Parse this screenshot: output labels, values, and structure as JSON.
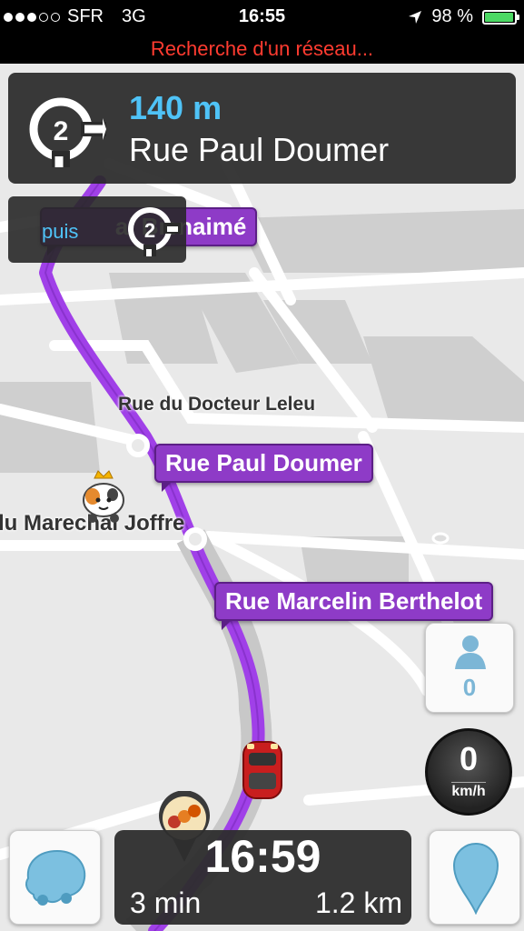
{
  "status_bar": {
    "carrier": "SFR",
    "network": "3G",
    "time": "16:55",
    "battery": "98 %",
    "battery_level": 0.98,
    "signal_bars_filled": 3,
    "signal_bars_total": 5
  },
  "network_banner": "Recherche d'un réseau...",
  "next_turn": {
    "distance": "140 m",
    "street": "Rue Paul Doumer",
    "exit_number": "2",
    "icon": "roundabout-icon"
  },
  "then_turn": {
    "label": "puis",
    "exit_number": "2",
    "icon": "roundabout-icon"
  },
  "map": {
    "street_labels": {
      "docteur_leleu": "Rue du Docteur Leleu",
      "marechal_joffre": "lu Marechal Joffre"
    },
    "route_bubbles": {
      "bienaime": "Rue Jean Bienaimé",
      "bienaime_visible": "al Bienaimé",
      "paul_doumer": "Rue Paul Doumer",
      "berthelot": "Rue Marcelin Berthelot"
    },
    "route_color": "#8e3bc7"
  },
  "side_buttons": {
    "users_count": "0",
    "users_icon": "person-icon"
  },
  "speedometer": {
    "speed": "0",
    "unit": "km/h"
  },
  "eta": {
    "arrival_time": "16:59",
    "duration": "3 min",
    "distance": "1.2 km"
  },
  "bottom_buttons": {
    "menu_icon": "waze-menu-icon",
    "report_icon": "report-pin-icon"
  }
}
